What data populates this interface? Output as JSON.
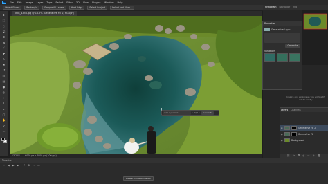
{
  "menubar": {
    "logo": "Ps",
    "items": [
      "File",
      "Edit",
      "Image",
      "Layer",
      "Type",
      "Select",
      "Filter",
      "3D",
      "View",
      "Plugins",
      "Window",
      "Help"
    ]
  },
  "options": {
    "buttons": [
      "Object Finder",
      "Rectangle",
      "Sample All Layers",
      "Hard Edge",
      "Select Subject",
      "Select and Mask..."
    ]
  },
  "document": {
    "tab_title": "IMG_4358.jpg @ 13.2% (Generative Fill 2, RGB/8*)"
  },
  "taskbar": {
    "prompt_placeholder": "Add a prompt...",
    "counter": "1/3",
    "generate_label": "Generate"
  },
  "status": {
    "zoom": "13.22%",
    "doc_info": "6000 px x 4000 px (300 ppi)"
  },
  "timeline": {
    "title": "Timeline",
    "create_button": "Create Frame Animation"
  },
  "panels": {
    "tabs": [
      "Histogram",
      "Navigator",
      "Info"
    ],
    "active_tab": "Histogram"
  },
  "properties": {
    "title": "Properties",
    "layer_label": "Generative Layer",
    "generate_button": "Generate",
    "variations_label": "Variations"
  },
  "info_text": "Inspire and explore as you work with Adobe Firefly.",
  "layers": {
    "tabs": [
      "Layers",
      "Channels"
    ],
    "active_tab": "Layers",
    "rows": [
      {
        "name": "Generative Fill 2",
        "selected": true
      },
      {
        "name": "Generative Fill",
        "selected": false
      },
      {
        "name": "Background",
        "selected": false
      }
    ]
  },
  "colors": {
    "accent": "#31a8ff",
    "panel_bg": "#2b2b2b",
    "selection": "#3c4a5c"
  }
}
